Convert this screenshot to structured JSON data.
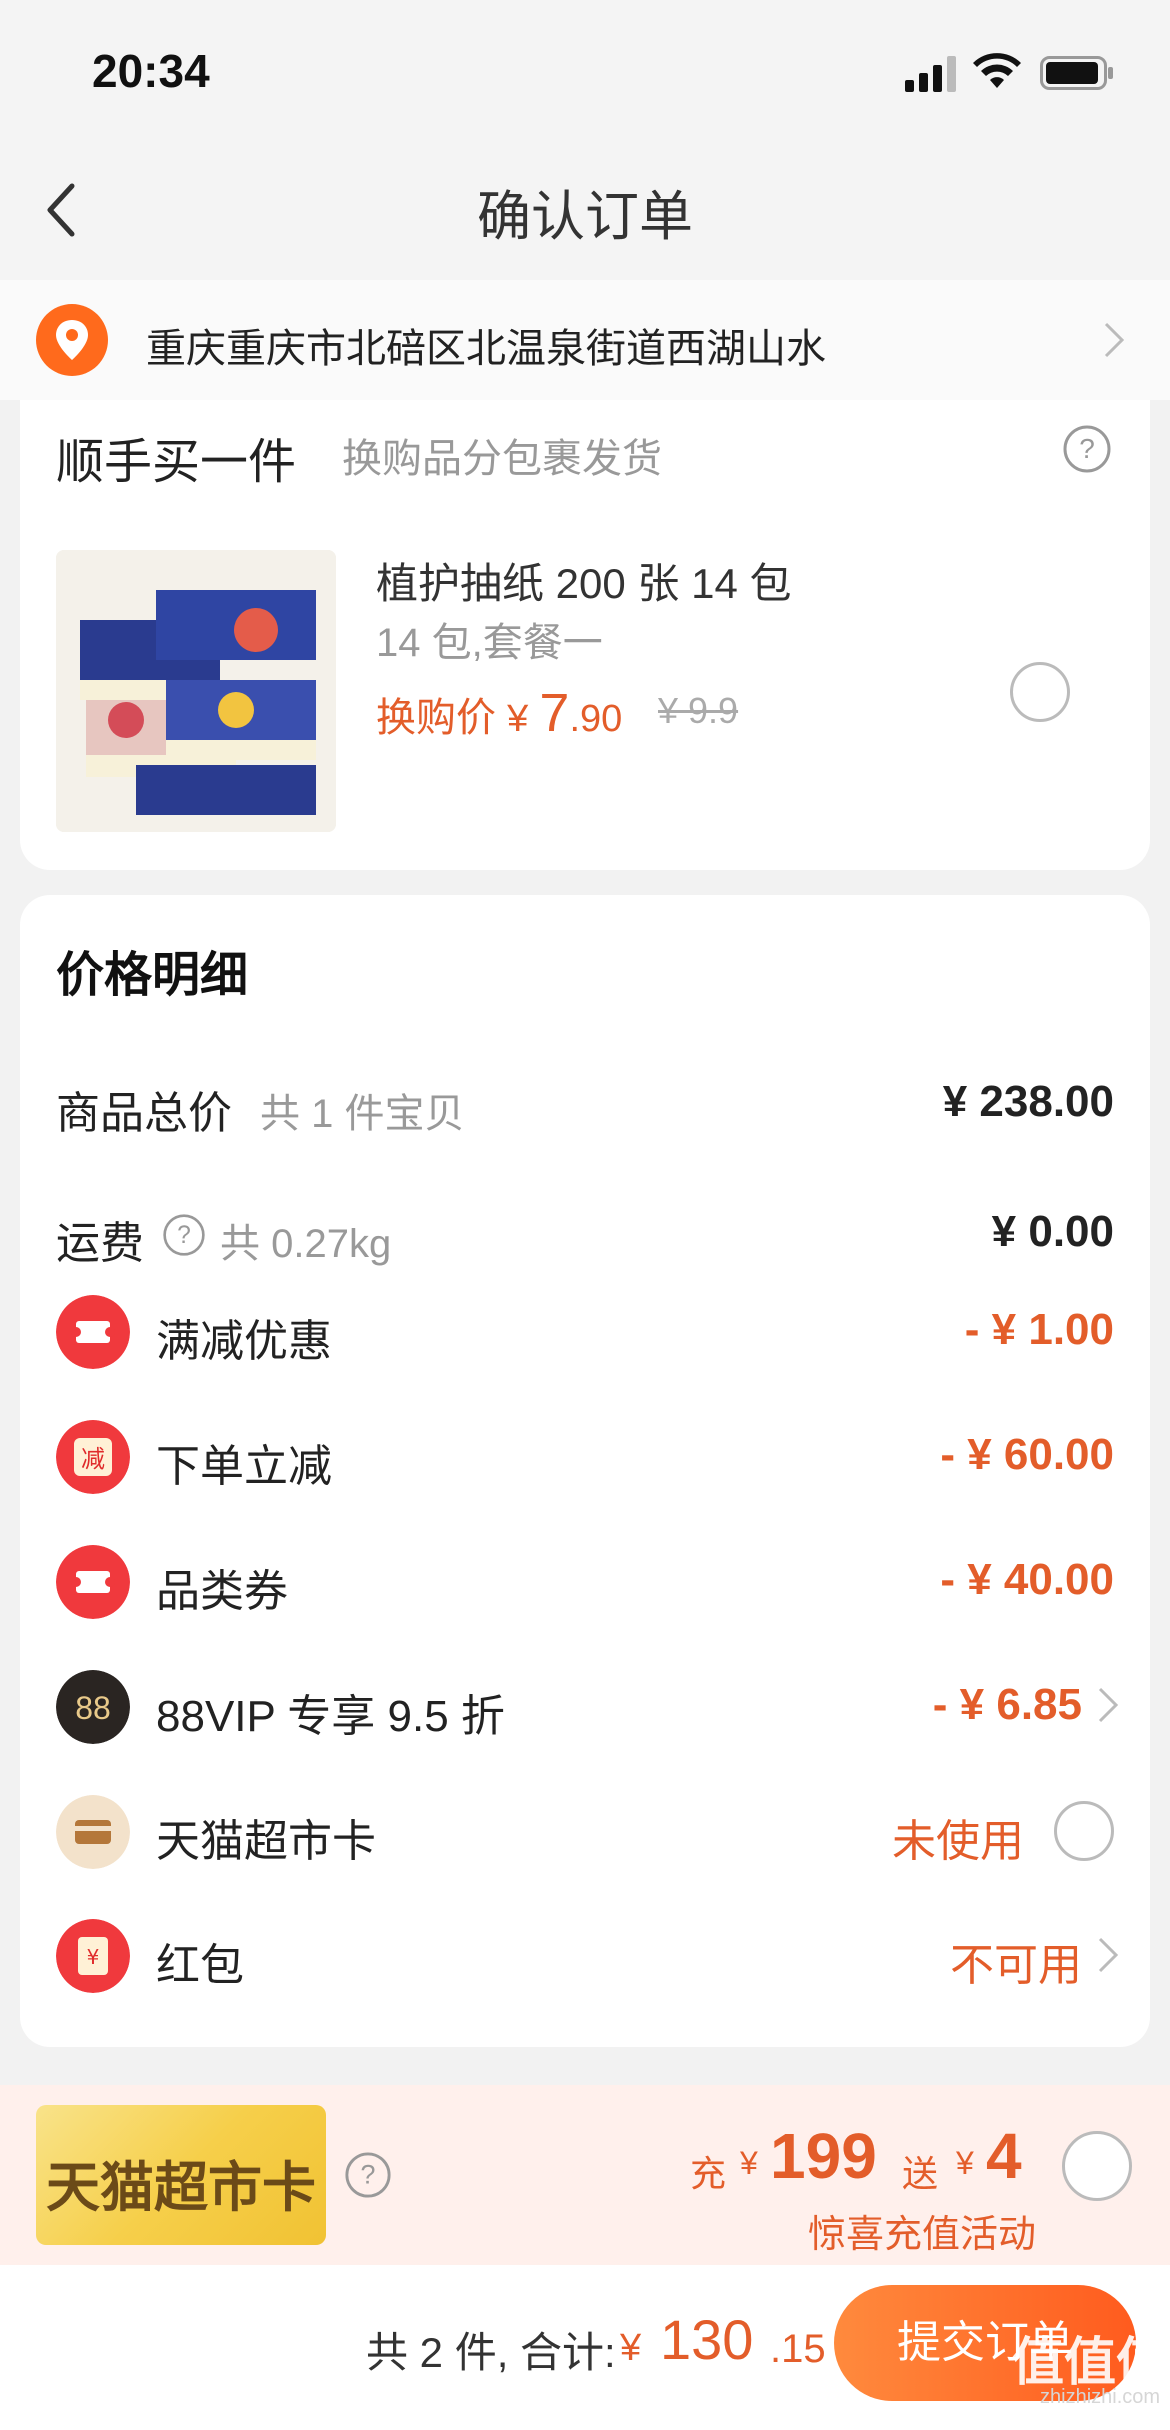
{
  "status_bar": {
    "time": "20:34"
  },
  "nav": {
    "title": "确认订单"
  },
  "address": {
    "text": "重庆重庆市北碚区北温泉街道西湖山水"
  },
  "add_on": {
    "title": "顺手买一件",
    "subtitle": "换购品分包裹发货",
    "product": {
      "name": "植护抽纸 200 张 14 包",
      "spec": "14 包,套餐一",
      "price_label": "换购价",
      "currency": "¥",
      "price_int": "7",
      "price_dec": ".90",
      "original_price": "¥ 9.9"
    }
  },
  "price_detail": {
    "title": "价格明细",
    "rows": [
      {
        "label": "商品总价",
        "sub": "共 1 件宝贝",
        "value": "¥ 238.00"
      },
      {
        "label": "运费",
        "sub": "共 0.27kg",
        "value": "¥ 0.00"
      },
      {
        "label": "满减优惠",
        "value": "- ¥ 1.00",
        "icon": "coupon-icon"
      },
      {
        "label": "下单立减",
        "value": "- ¥ 60.00",
        "icon": "instant-discount-icon",
        "icon_text": "减"
      },
      {
        "label": "品类券",
        "value": "- ¥ 40.00",
        "icon": "category-coupon-icon"
      },
      {
        "label": "88VIP 专享 9.5 折",
        "value": "- ¥ 6.85",
        "icon": "vip88-icon",
        "icon_text": "88"
      },
      {
        "label": "天猫超市卡",
        "value": "未使用",
        "icon": "card-icon"
      },
      {
        "label": "红包",
        "value": "不可用",
        "icon": "red-envelope-icon",
        "icon_text": "¥"
      }
    ]
  },
  "promo": {
    "card_text": "天猫超市卡",
    "charge_label": "充",
    "charge_amount": "199",
    "bonus_label": "送",
    "bonus_amount": "4",
    "currency": "¥",
    "subtitle": "惊喜充值活动"
  },
  "bottom_bar": {
    "count_text": "共 2 件,  合计:",
    "currency": "¥",
    "total_int": "130",
    "total_dec": ".15",
    "submit_label": "提交订单"
  },
  "watermark": {
    "text": "值值值",
    "sub": "zhizhizhi.com"
  },
  "colors": {
    "accent": "#e35d2a",
    "submit_start": "#ff8a3d",
    "submit_end": "#ff5b1e",
    "icon_red": "#f0393d"
  }
}
